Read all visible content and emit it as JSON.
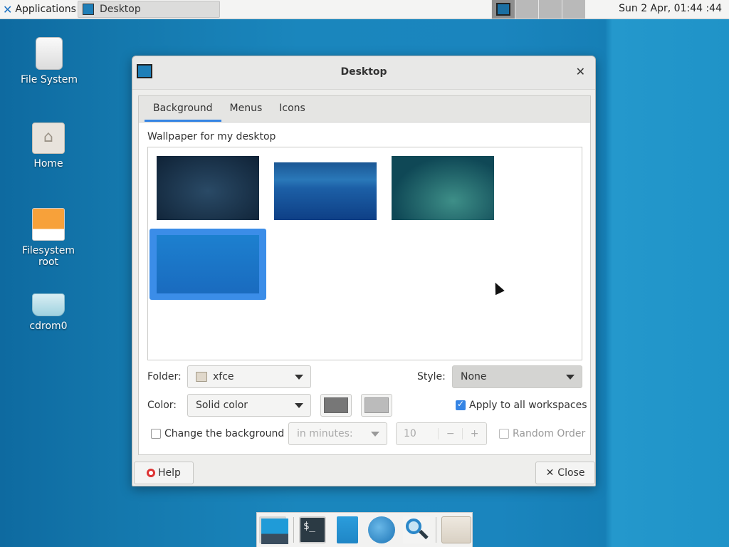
{
  "top_panel": {
    "applications_label": "Applications",
    "task_title": "Desktop",
    "clock": "Sun  2 Apr, 01:44  :44"
  },
  "desktop_icons": [
    {
      "label": "File System",
      "icon": "drive-icon"
    },
    {
      "label": "Home",
      "icon": "home-folder-icon"
    },
    {
      "label": "Filesystem root",
      "icon": "root-drive-icon"
    },
    {
      "label": "cdrom0",
      "icon": "cdrom-icon"
    }
  ],
  "dialog": {
    "title": "Desktop",
    "tabs": [
      "Background",
      "Menus",
      "Icons"
    ],
    "active_tab": "Background",
    "wallpaper_label": "Wallpaper for my desktop",
    "wallpapers_count_selected_index": 3,
    "folder_label": "Folder:",
    "folder_value": "xfce",
    "style_label": "Style:",
    "style_value": "None",
    "color_label": "Color:",
    "color_value": "Solid color",
    "color1": "#777777",
    "color2": "#bbbbbb",
    "apply_all_label": "Apply to all workspaces",
    "apply_all_checked": true,
    "change_bg_label": "Change the background",
    "change_bg_checked": false,
    "interval_unit": "in minutes:",
    "interval_value": "10",
    "random_order_label": "Random Order",
    "help_label": "Help",
    "close_label": "Close"
  },
  "dock": {
    "items": [
      "desktop-icon",
      "terminal-icon",
      "file-manager-icon",
      "web-browser-icon",
      "app-finder-icon",
      "folder-icon"
    ],
    "terminal_glyph": "$_"
  }
}
